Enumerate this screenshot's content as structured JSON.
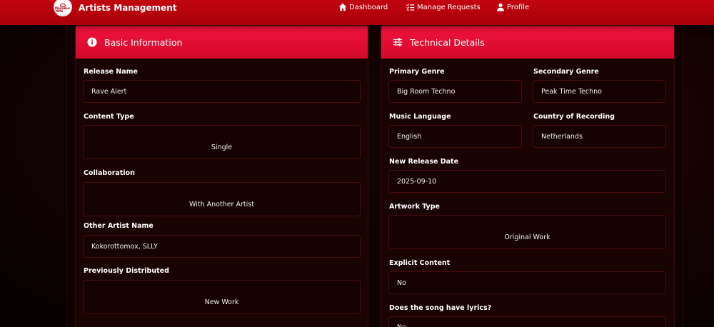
{
  "nav": {
    "brand_title": "Artists Management",
    "logo_text": "MadaBen MMG",
    "dashboard": "Dashboard",
    "manage_requests": "Manage Requests",
    "profile": "Profile"
  },
  "basic": {
    "header": "Basic Information",
    "release_name_label": "Release Name",
    "release_name_value": "Rave Alert",
    "content_type_label": "Content Type",
    "content_type_value": "Single",
    "collaboration_label": "Collaboration",
    "collaboration_value": "With Another Artist",
    "other_artist_label": "Other Artist Name",
    "other_artist_value": "Kokorottomox, SLLY",
    "previously_distributed_label": "Previously Distributed",
    "previously_distributed_value": "New Work"
  },
  "technical": {
    "header": "Technical Details",
    "primary_genre_label": "Primary Genre",
    "primary_genre_value": "Big Room Techno",
    "secondary_genre_label": "Secondary Genre",
    "secondary_genre_value": "Peak Time Techno",
    "music_language_label": "Music Language",
    "music_language_value": "English",
    "country_label": "Country of Recording",
    "country_value": "Netherlands",
    "release_date_label": "New Release Date",
    "release_date_value": "2025-09-10",
    "artwork_type_label": "Artwork Type",
    "artwork_type_value": "Original Work",
    "explicit_label": "Explicit Content",
    "explicit_value": "No",
    "lyrics_label": "Does the song have lyrics?",
    "lyrics_value": "No"
  },
  "colors": {
    "navbar": "#b80009",
    "card_header": "#e80f34",
    "background": "#120202"
  }
}
